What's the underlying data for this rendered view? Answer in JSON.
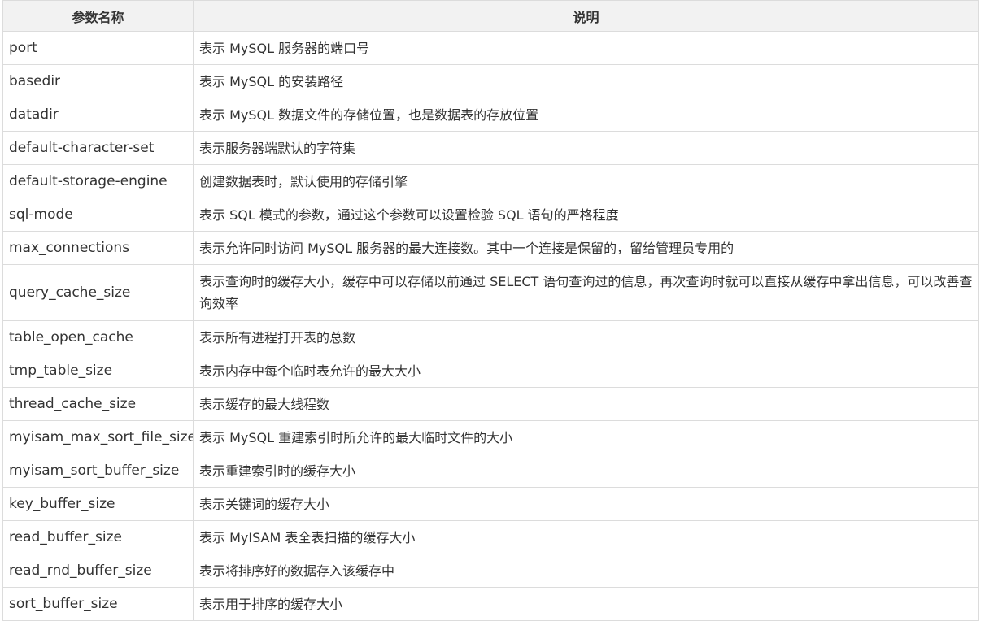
{
  "header": {
    "param_name": "参数名称",
    "description": "说明"
  },
  "rows": [
    {
      "name": "port",
      "desc": "表示 MySQL 服务器的端口号"
    },
    {
      "name": "basedir",
      "desc": "表示 MySQL 的安装路径"
    },
    {
      "name": "datadir",
      "desc": "表示 MySQL 数据文件的存储位置，也是数据表的存放位置"
    },
    {
      "name": "default-character-set",
      "desc": "表示服务器端默认的字符集"
    },
    {
      "name": "default-storage-engine",
      "desc": "创建数据表时，默认使用的存储引擎"
    },
    {
      "name": "sql-mode",
      "desc": "表示 SQL 模式的参数，通过这个参数可以设置检验 SQL 语句的严格程度"
    },
    {
      "name": "max_connections",
      "desc": "表示允许同时访问 MySQL 服务器的最大连接数。其中一个连接是保留的，留给管理员专用的"
    },
    {
      "name": "query_cache_size",
      "desc": "表示查询时的缓存大小，缓存中可以存储以前通过 SELECT 语句查询过的信息，再次查询时就可以直接从缓存中拿出信息，可以改善查询效率"
    },
    {
      "name": "table_open_cache",
      "desc": "表示所有进程打开表的总数"
    },
    {
      "name": "tmp_table_size",
      "desc": "表示内存中每个临时表允许的最大大小"
    },
    {
      "name": "thread_cache_size",
      "desc": "表示缓存的最大线程数"
    },
    {
      "name": "myisam_max_sort_file_size",
      "desc": "表示 MySQL 重建索引时所允许的最大临时文件的大小"
    },
    {
      "name": "myisam_sort_buffer_size",
      "desc": "表示重建索引时的缓存大小"
    },
    {
      "name": "key_buffer_size",
      "desc": "表示关键词的缓存大小"
    },
    {
      "name": "read_buffer_size",
      "desc": "表示 MyISAM 表全表扫描的缓存大小"
    },
    {
      "name": "read_rnd_buffer_size",
      "desc": "表示将排序好的数据存入该缓存中"
    },
    {
      "name": "sort_buffer_size",
      "desc": "表示用于排序的缓存大小"
    }
  ]
}
